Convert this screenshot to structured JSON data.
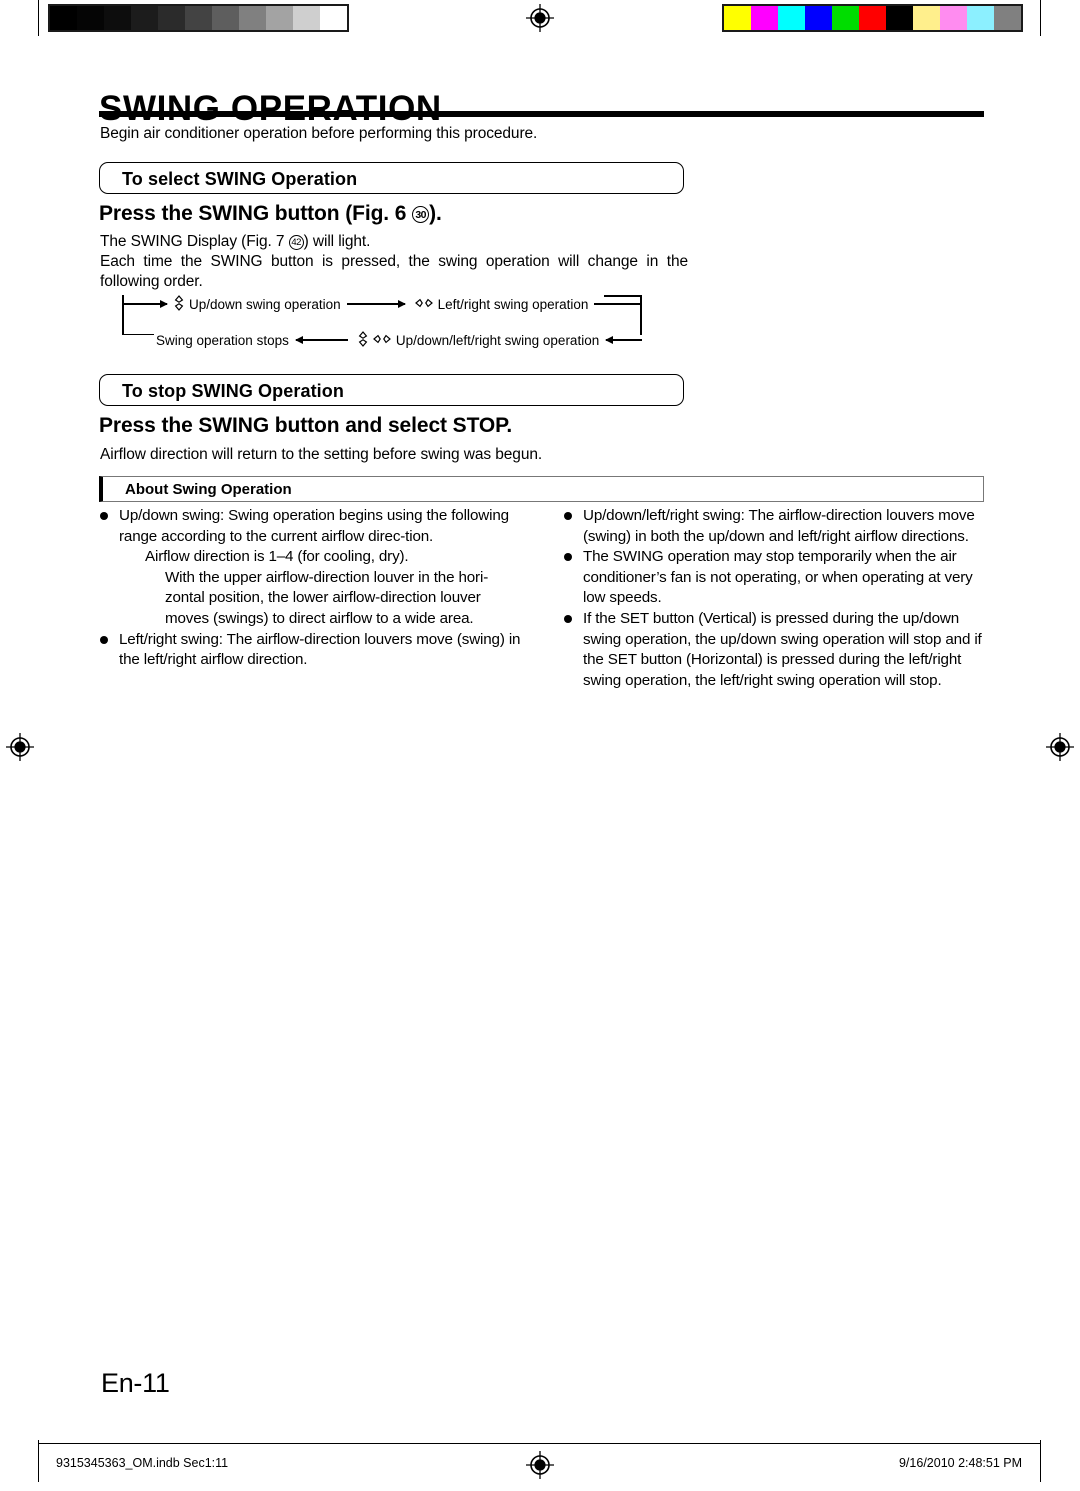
{
  "print_marks": {
    "gray_wedge": [
      "#000000",
      "#050505",
      "#0d0d0d",
      "#1c1c1c",
      "#2b2b2b",
      "#434343",
      "#5e5e5e",
      "#808080",
      "#a3a3a3",
      "#cfcfcf",
      "#ffffff"
    ],
    "color_bar": [
      "#ffff00",
      "#ff00ff",
      "#00ffff",
      "#0000ff",
      "#00dd00",
      "#ff0000",
      "#000000",
      "#ffef8c",
      "#ff8cf0",
      "#8cf0ff",
      "#808080"
    ],
    "registration_icon": "registration-target-icon"
  },
  "header": {
    "title": "SWING OPERATION",
    "intro": "Begin air conditioner operation before performing this procedure."
  },
  "sections": {
    "select": {
      "box_label": "To select SWING Operation",
      "step_prefix": "Press the SWING button (Fig. 6 ",
      "step_circled": "30",
      "step_suffix": ").",
      "display_prefix": "The SWING Display (Fig. 7 ",
      "display_circled": "42",
      "display_suffix": ") will light.",
      "order_text": "Each time the SWING button is pressed, the swing operation will change in the following order."
    },
    "stop": {
      "box_label": "To stop SWING Operation",
      "step_heading": "Press the SWING button and select STOP.",
      "note": "Airflow direction will return to the setting before swing was begun."
    }
  },
  "flow": {
    "node_updown": "Up/down swing operation",
    "node_leftright": "Left/right swing operation",
    "node_both": "Up/down/left/right swing operation",
    "node_stop": "Swing operation stops",
    "icon_updown": "updown-swing-icon",
    "icon_leftright": "leftright-swing-icon"
  },
  "about": {
    "box_label": "About Swing Operation",
    "left_column": [
      {
        "kind": "bullet",
        "text": "Up/down swing: Swing operation begins using the following range according to the current airflow direc-tion."
      },
      {
        "kind": "indent",
        "text": "Airflow direction is 1–4 (for cooling, dry)."
      },
      {
        "kind": "indent2",
        "text": "With the upper airflow-direction louver in the hori-zontal position, the lower airflow-direction louver moves (swings) to direct airflow to a wide area."
      },
      {
        "kind": "bullet",
        "text": "Left/right swing: The airflow-direction louvers move (swing) in the left/right airflow direction."
      }
    ],
    "right_column": [
      {
        "kind": "bullet",
        "text": "Up/down/left/right swing: The airflow-direction louvers move (swing) in both the up/down and left/right airflow directions."
      },
      {
        "kind": "bullet",
        "text": "The SWING operation may stop temporarily when the air conditioner’s fan is not operating, or when operating at very low speeds."
      },
      {
        "kind": "bullet",
        "text": "If the SET button (Vertical) is pressed during the up/down swing operation, the up/down swing operation will stop and if the SET button (Horizontal) is pressed during the left/right swing operation, the left/right swing operation will stop."
      }
    ]
  },
  "footer": {
    "page_number": "En-11",
    "file_info": "9315345363_OM.indb   Sec1:11",
    "timestamp": "9/16/2010   2:48:51 PM"
  }
}
